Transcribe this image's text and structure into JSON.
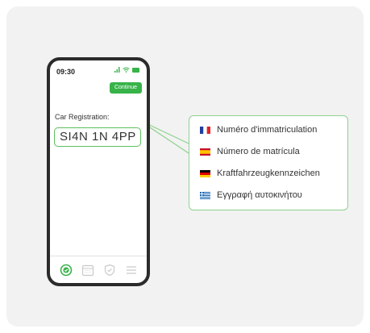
{
  "phone": {
    "time": "09:30",
    "continue_label": "Continue",
    "field_label": "Car Registration:",
    "registration_value": "SI4N 1N 4PP"
  },
  "status_icons": [
    "signal-icon",
    "wifi-icon",
    "battery-icon"
  ],
  "bottom_nav": [
    "check-circle-icon",
    "calendar-icon",
    "shield-check-icon",
    "menu-icon"
  ],
  "translations": [
    {
      "flag": "france-flag-icon",
      "text": "Numéro d'immatriculation"
    },
    {
      "flag": "spain-flag-icon",
      "text": "Número de matrícula"
    },
    {
      "flag": "germany-flag-icon",
      "text": "Kraftfahrzeugkennzeichen"
    },
    {
      "flag": "greece-flag-icon",
      "text": "Εγγραφή αυτοκινήτου"
    }
  ],
  "colors": {
    "accent_green": "#38b34a",
    "input_border": "#5cbf5c",
    "callout_border": "#8fd18f",
    "card_background": "#f2f2f2",
    "phone_frame": "#2b2b2b"
  }
}
